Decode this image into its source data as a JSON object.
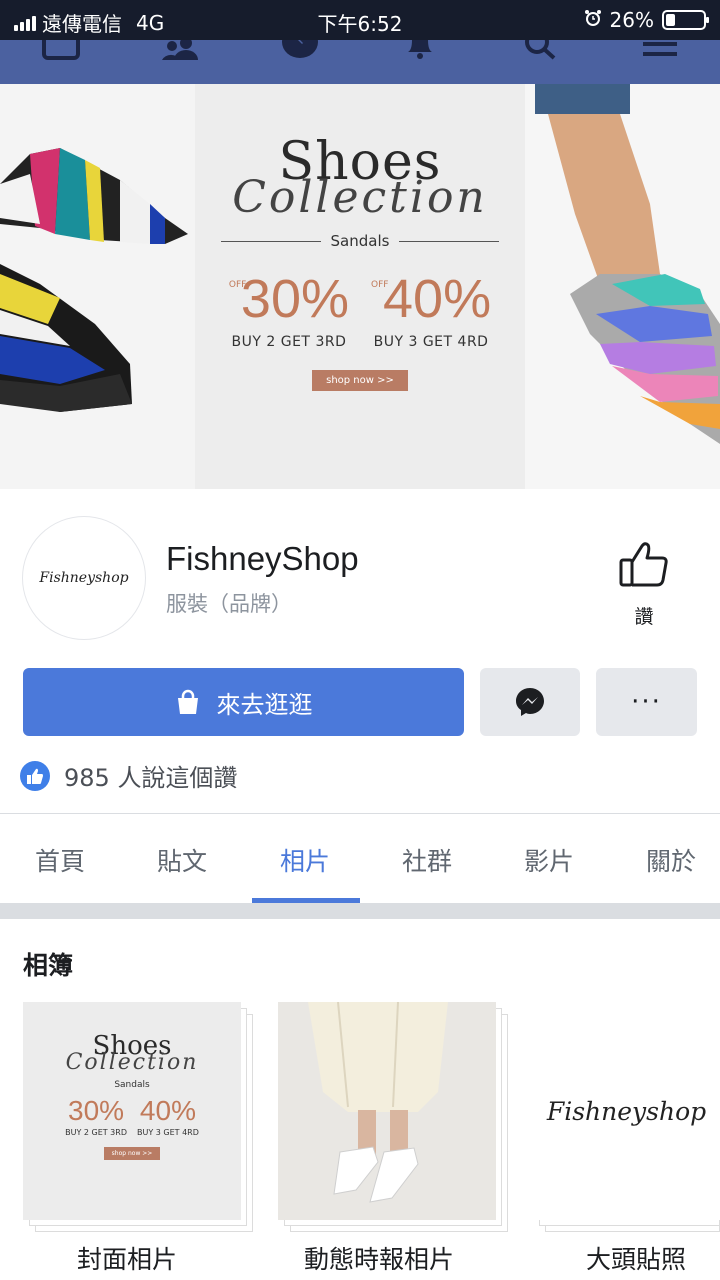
{
  "status_bar": {
    "carrier": "遠傳電信",
    "network": "4G",
    "time": "下午6:52",
    "battery": "26%",
    "battery_level": 0.26
  },
  "nav_icons": [
    "home-icon",
    "friends-icon",
    "messenger-icon",
    "notifications-icon",
    "search-icon",
    "menu-icon"
  ],
  "cover": {
    "title": "Shoes",
    "script": "Collection",
    "subtitle": "Sandals",
    "offer1_pct": "30%",
    "offer1_off": "OFF",
    "offer1_text": "BUY 2 GET 3RD",
    "offer2_pct": "40%",
    "offer2_off": "OFF",
    "offer2_text": "BUY 3 GET 4RD",
    "cta": "shop now >>"
  },
  "page": {
    "avatar_text": "Fishneyshop",
    "name": "FishneyShop",
    "category": "服裝（品牌）",
    "like_label": "讚"
  },
  "actions": {
    "shop_label": "來去逛逛",
    "more_label": "···"
  },
  "likes": {
    "text": "985 人說這個讚"
  },
  "tabs": [
    {
      "label": "首頁"
    },
    {
      "label": "貼文"
    },
    {
      "label": "相片"
    },
    {
      "label": "社群"
    },
    {
      "label": "影片"
    },
    {
      "label": "關於"
    }
  ],
  "active_tab": "相片",
  "albums": {
    "title": "相簿",
    "items": [
      {
        "label": "封面相片"
      },
      {
        "label": "動態時報相片"
      },
      {
        "label": "大頭貼照",
        "thumb_text": "Fishneyshop"
      }
    ]
  },
  "colors": {
    "status_bg": "#161c2c",
    "nav_bg": "#4b61a0",
    "primary": "#4b79da",
    "offer": "#c17a5a"
  }
}
